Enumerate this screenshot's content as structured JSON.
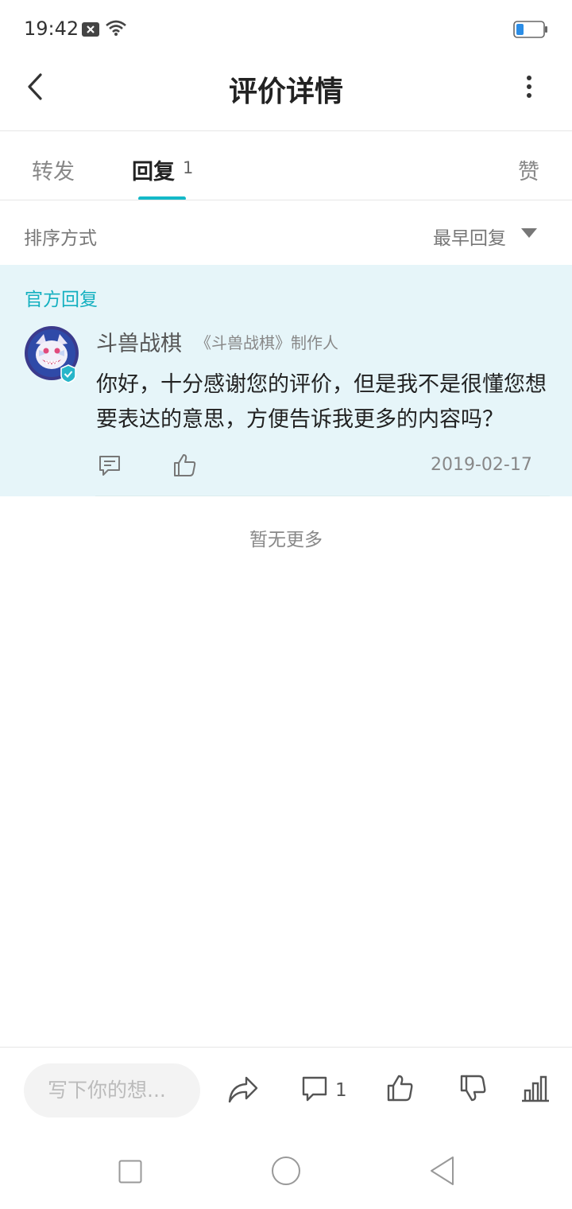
{
  "status_bar": {
    "time": "19:42"
  },
  "header": {
    "title": "评价详情"
  },
  "tabs": {
    "forward": "转发",
    "reply": "回复",
    "reply_count": "1",
    "like": "赞"
  },
  "sort": {
    "label": "排序方式",
    "value": "最早回复"
  },
  "official_reply": {
    "section_label": "官方回复",
    "author_name": "斗兽战棋",
    "author_role": "《斗兽战棋》制作人",
    "text": "你好，十分感谢您的评价，但是我不是很懂您想要表达的意思，方便告诉我更多的内容吗？",
    "date": "2019-02-17"
  },
  "list_end": "暂无更多",
  "bottom_bar": {
    "input_placeholder": "写下你的想...",
    "comment_count": "1"
  },
  "colors": {
    "accent": "#14b9c8",
    "card_bg": "#e6f5f9"
  },
  "icons": [
    "back-icon",
    "more-icon",
    "chevron-down-icon",
    "comment-icon",
    "thumbs-up-icon",
    "share-icon",
    "thumbs-down-icon",
    "stats-icon"
  ]
}
